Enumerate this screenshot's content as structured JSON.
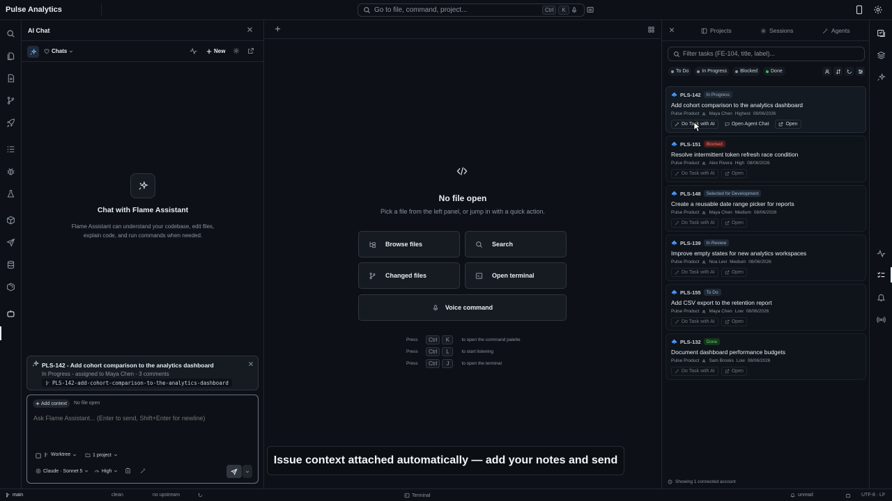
{
  "app": {
    "title": "Pulse Analytics"
  },
  "command_search": {
    "placeholder": "Go to file, command, project...",
    "key1": "Ctrl",
    "key2": "K"
  },
  "icons": {
    "activity_bar": [
      "search-icon",
      "files-icon",
      "document-icon",
      "git-branch-icon",
      "rocket-icon",
      "list-icon",
      "bug-icon",
      "flask-icon",
      "package-icon",
      "send-icon",
      "database-icon",
      "box-icon",
      "robot-icon"
    ],
    "right_bar": [
      "tasks-icon",
      "layers-icon",
      "sparkle-icon",
      "pulse-icon",
      "checklist-icon",
      "bell-icon",
      "broadcast-icon"
    ]
  },
  "chat_panel": {
    "title": "AI Chat",
    "chats_label": "Chats",
    "new_label": "New",
    "empty_title": "Chat with Flame Assistant",
    "empty_desc": "Flame Assistant can understand your codebase, edit files, explain code, and run commands when needed."
  },
  "issue_context": {
    "title": "PLS-142 - Add cohort comparison to the analytics dashboard",
    "meta": "In Progress - assigned to Maya Chen - 3 comments",
    "branch": "PLS-142-add-cohort-comparison-to-the-analytics-dashboard"
  },
  "composer": {
    "add_context": "Add context",
    "no_file": "No file open",
    "placeholder": "Ask Flame Assistant... (Enter to send, Shift+Enter for newline)",
    "worktree": "Worktree",
    "project": "1 project",
    "model": "Claude · Sonnet 5",
    "effort": "High"
  },
  "editor": {
    "nofile_title": "No file open",
    "nofile_sub": "Pick a file from the left panel, or jump in with a quick action.",
    "actions": {
      "browse": "Browse files",
      "search": "Search",
      "changed": "Changed files",
      "terminal": "Open terminal",
      "voice": "Voice command"
    },
    "hints": [
      {
        "press": "Press",
        "k1": "Ctrl",
        "k2": "K",
        "desc": "to open the command palette"
      },
      {
        "press": "Press",
        "k1": "Ctrl",
        "k2": "L",
        "desc": "to start listening"
      },
      {
        "press": "Press",
        "k1": "Ctrl",
        "k2": "J",
        "desc": "to open the terminal"
      }
    ],
    "caption": "Issue context attached automatically — add your notes and send"
  },
  "task_panel": {
    "tabs": {
      "projects": "Projects",
      "sessions": "Sessions",
      "agents": "Agents"
    },
    "filter_placeholder": "Filter tasks (FE-104, title, label)...",
    "pills": [
      {
        "label": "To Do",
        "color": "#8b949e"
      },
      {
        "label": "In Progress",
        "color": "#8b949e"
      },
      {
        "label": "Blocked",
        "color": "#8b949e"
      },
      {
        "label": "Done",
        "color": "#3fb950"
      }
    ],
    "actions": {
      "do_task": "Do Task with AI",
      "open_chat": "Open Agent Chat",
      "open": "Open"
    },
    "tasks": [
      {
        "id": "PLS-142",
        "status": "In Progress",
        "status_bg": "#1f2a36",
        "status_fg": "#9fb3c8",
        "title": "Add cohort comparison to the analytics dashboard",
        "project": "Pulse Product",
        "assignee": "Maya Chen",
        "priority": "Highest",
        "date": "08/06/2026"
      },
      {
        "id": "PLS-151",
        "status": "Blocked",
        "status_bg": "#4a1c1c",
        "status_fg": "#ff7b72",
        "title": "Resolve intermittent token refresh race condition",
        "project": "Pulse Product",
        "assignee": "Alex Rivera",
        "priority": "High",
        "date": "08/06/2026"
      },
      {
        "id": "PLS-148",
        "status": "Selected for Development",
        "status_bg": "#1f2a36",
        "status_fg": "#9fb3c8",
        "title": "Create a reusable date range picker for reports",
        "project": "Pulse Product",
        "assignee": "Maya Chen",
        "priority": "Medium",
        "date": "08/06/2026"
      },
      {
        "id": "PLS-139",
        "status": "In Review",
        "status_bg": "#1f2a36",
        "status_fg": "#9fb3c8",
        "title": "Improve empty states for new analytics workspaces",
        "project": "Pulse Product",
        "assignee": "Noa Levi",
        "priority": "Medium",
        "date": "08/06/2026"
      },
      {
        "id": "PLS-155",
        "status": "To Do",
        "status_bg": "#1f2a36",
        "status_fg": "#9fb3c8",
        "title": "Add CSV export to the retention report",
        "project": "Pulse Product",
        "assignee": "Maya Chen",
        "priority": "Low",
        "date": "08/06/2026"
      },
      {
        "id": "PLS-132",
        "status": "Done",
        "status_bg": "#17341f",
        "status_fg": "#56d364",
        "title": "Document dashboard performance budgets",
        "project": "Pulse Product",
        "assignee": "Sam Brooks",
        "priority": "Low",
        "date": "08/06/2026"
      }
    ],
    "footer": "Showing 1 connected account"
  },
  "statusbar": {
    "branch": "main",
    "clean": "clean",
    "upstream": "no upstream",
    "terminal": "Terminal",
    "unread": "unread",
    "encoding": "UTF-8 · LF"
  }
}
